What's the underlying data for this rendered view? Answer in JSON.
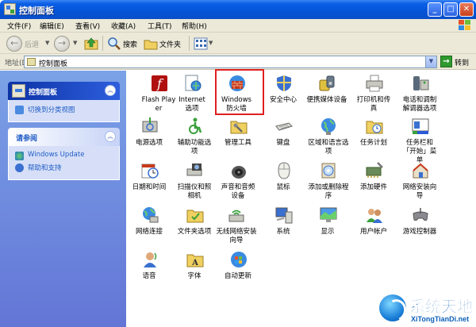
{
  "window": {
    "title": "控制面板"
  },
  "menu": [
    "文件(F)",
    "编辑(E)",
    "查看(V)",
    "收藏(A)",
    "工具(T)",
    "帮助(H)"
  ],
  "toolbar": {
    "back": "后退",
    "search": "搜索",
    "folders": "文件夹"
  },
  "address": {
    "label": "地址(D)",
    "value": "控制面板",
    "go": "转到"
  },
  "left_panel": {
    "control_panel": {
      "title": "控制面板",
      "link": "切换到分类视图"
    },
    "see_also": {
      "title": "请参阅",
      "links": [
        "Windows Update",
        "帮助和支持"
      ]
    }
  },
  "items": [
    {
      "label": "Flash Player",
      "icon": "flash-icon"
    },
    {
      "label": "Internet 选项",
      "icon": "internet-options-icon"
    },
    {
      "label": "Windows 防火墙",
      "icon": "firewall-icon"
    },
    {
      "label": "安全中心",
      "icon": "security-center-icon"
    },
    {
      "label": "便携媒体设备",
      "icon": "portable-media-icon"
    },
    {
      "label": "打印机和传真",
      "icon": "printer-icon"
    },
    {
      "label": "电话和调制解调器选项",
      "icon": "phone-modem-icon"
    },
    {
      "label": "电源选项",
      "icon": "power-icon"
    },
    {
      "label": "辅助功能选项",
      "icon": "accessibility-icon"
    },
    {
      "label": "管理工具",
      "icon": "admin-tools-icon"
    },
    {
      "label": "键盘",
      "icon": "keyboard-icon"
    },
    {
      "label": "区域和语言选项",
      "icon": "region-language-icon"
    },
    {
      "label": "任务计划",
      "icon": "scheduled-tasks-icon"
    },
    {
      "label": "任务栏和「开始」菜单",
      "icon": "taskbar-start-icon"
    },
    {
      "label": "日期和时间",
      "icon": "date-time-icon"
    },
    {
      "label": "扫描仪和照相机",
      "icon": "scanner-camera-icon"
    },
    {
      "label": "声音和音频设备",
      "icon": "sound-audio-icon"
    },
    {
      "label": "鼠标",
      "icon": "mouse-icon"
    },
    {
      "label": "添加或删除程序",
      "icon": "add-remove-programs-icon"
    },
    {
      "label": "添加硬件",
      "icon": "add-hardware-icon"
    },
    {
      "label": "网络安装向导",
      "icon": "network-setup-icon"
    },
    {
      "label": "网络连接",
      "icon": "network-connections-icon"
    },
    {
      "label": "文件夹选项",
      "icon": "folder-options-icon"
    },
    {
      "label": "无线网络安装向导",
      "icon": "wireless-setup-icon"
    },
    {
      "label": "系统",
      "icon": "system-icon"
    },
    {
      "label": "显示",
      "icon": "display-icon"
    },
    {
      "label": "用户帐户",
      "icon": "user-accounts-icon"
    },
    {
      "label": "游戏控制器",
      "icon": "game-controller-icon"
    },
    {
      "label": "语音",
      "icon": "speech-icon"
    },
    {
      "label": "字体",
      "icon": "fonts-icon"
    },
    {
      "label": "自动更新",
      "icon": "automatic-updates-icon"
    }
  ],
  "watermark": {
    "title": "系统天地",
    "subtitle": "XiTongTianDi.net"
  },
  "colors": {
    "titlebar": "#0454d6",
    "taskpane": "#6f8fe0",
    "highlight": "#e02020",
    "link": "#215dc6"
  }
}
